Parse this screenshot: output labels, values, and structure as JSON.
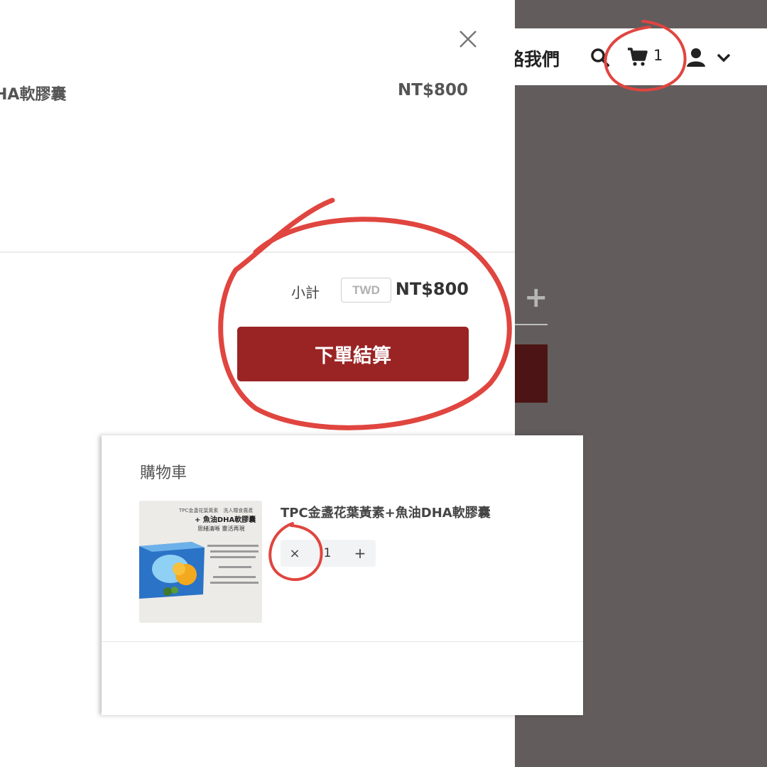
{
  "header": {
    "nav_contact": "絡我們",
    "cart_count": "1"
  },
  "drawer": {
    "item_name": "HA軟膠囊",
    "item_price": "NT$800",
    "subtotal_label": "小計",
    "currency": "TWD",
    "subtotal_value": "NT$800",
    "checkout_label": "下單結算"
  },
  "cart_panel": {
    "title": "購物車",
    "product": {
      "name": "TPC金盞花葉黃素+魚油DHA軟膠囊",
      "quantity": "1",
      "remove_symbol": "×",
      "add_symbol": "+",
      "image_text": {
        "line1": "TPC金盞花葉黃素　洗人糧食農產",
        "line2": "+ 魚油DHA軟膠囊",
        "line3": "思緒清晰 靈活再現"
      }
    }
  },
  "background": {
    "plus_symbol": "+"
  },
  "colors": {
    "checkout": "#9a2424",
    "annotation": "#e0453f",
    "overlay": "#625c5d"
  }
}
